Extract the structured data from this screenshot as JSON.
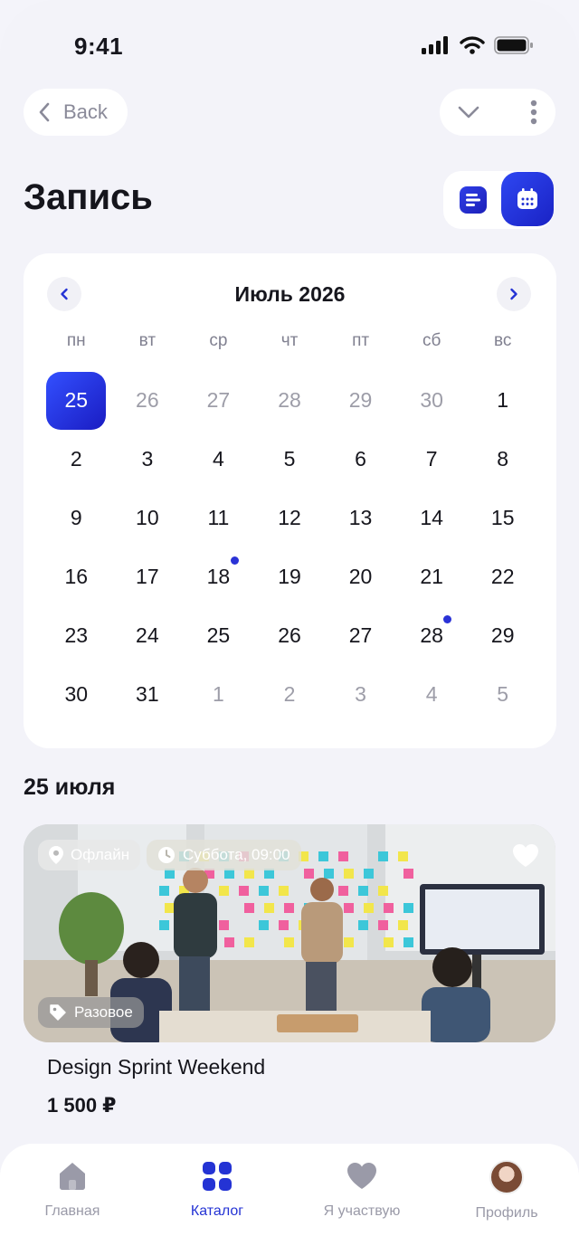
{
  "status_bar": {
    "time": "9:41"
  },
  "nav": {
    "back_label": "Back"
  },
  "page": {
    "title": "Запись"
  },
  "calendar": {
    "month_label": "Июль 2026",
    "weekdays": [
      "пн",
      "вт",
      "ср",
      "чт",
      "пт",
      "сб",
      "вс"
    ],
    "days": [
      {
        "label": "25",
        "muted": false,
        "selected": true,
        "event": false
      },
      {
        "label": "26",
        "muted": true,
        "selected": false,
        "event": false
      },
      {
        "label": "27",
        "muted": true,
        "selected": false,
        "event": false
      },
      {
        "label": "28",
        "muted": true,
        "selected": false,
        "event": false
      },
      {
        "label": "29",
        "muted": true,
        "selected": false,
        "event": false
      },
      {
        "label": "30",
        "muted": true,
        "selected": false,
        "event": false
      },
      {
        "label": "1",
        "muted": false,
        "selected": false,
        "event": false
      },
      {
        "label": "2",
        "muted": false,
        "selected": false,
        "event": false
      },
      {
        "label": "3",
        "muted": false,
        "selected": false,
        "event": false
      },
      {
        "label": "4",
        "muted": false,
        "selected": false,
        "event": false
      },
      {
        "label": "5",
        "muted": false,
        "selected": false,
        "event": false
      },
      {
        "label": "6",
        "muted": false,
        "selected": false,
        "event": false
      },
      {
        "label": "7",
        "muted": false,
        "selected": false,
        "event": false
      },
      {
        "label": "8",
        "muted": false,
        "selected": false,
        "event": false
      },
      {
        "label": "9",
        "muted": false,
        "selected": false,
        "event": false
      },
      {
        "label": "10",
        "muted": false,
        "selected": false,
        "event": false
      },
      {
        "label": "11",
        "muted": false,
        "selected": false,
        "event": false
      },
      {
        "label": "12",
        "muted": false,
        "selected": false,
        "event": false
      },
      {
        "label": "13",
        "muted": false,
        "selected": false,
        "event": false
      },
      {
        "label": "14",
        "muted": false,
        "selected": false,
        "event": false
      },
      {
        "label": "15",
        "muted": false,
        "selected": false,
        "event": false
      },
      {
        "label": "16",
        "muted": false,
        "selected": false,
        "event": false
      },
      {
        "label": "17",
        "muted": false,
        "selected": false,
        "event": false
      },
      {
        "label": "18",
        "muted": false,
        "selected": false,
        "event": true
      },
      {
        "label": "19",
        "muted": false,
        "selected": false,
        "event": false
      },
      {
        "label": "20",
        "muted": false,
        "selected": false,
        "event": false
      },
      {
        "label": "21",
        "muted": false,
        "selected": false,
        "event": false
      },
      {
        "label": "22",
        "muted": false,
        "selected": false,
        "event": false
      },
      {
        "label": "23",
        "muted": false,
        "selected": false,
        "event": false
      },
      {
        "label": "24",
        "muted": false,
        "selected": false,
        "event": false
      },
      {
        "label": "25",
        "muted": false,
        "selected": false,
        "event": false
      },
      {
        "label": "26",
        "muted": false,
        "selected": false,
        "event": false
      },
      {
        "label": "27",
        "muted": false,
        "selected": false,
        "event": false
      },
      {
        "label": "28",
        "muted": false,
        "selected": false,
        "event": true
      },
      {
        "label": "29",
        "muted": false,
        "selected": false,
        "event": false
      },
      {
        "label": "30",
        "muted": false,
        "selected": false,
        "event": false
      },
      {
        "label": "31",
        "muted": false,
        "selected": false,
        "event": false
      },
      {
        "label": "1",
        "muted": true,
        "selected": false,
        "event": false
      },
      {
        "label": "2",
        "muted": true,
        "selected": false,
        "event": false
      },
      {
        "label": "3",
        "muted": true,
        "selected": false,
        "event": false
      },
      {
        "label": "4",
        "muted": true,
        "selected": false,
        "event": false
      },
      {
        "label": "5",
        "muted": true,
        "selected": false,
        "event": false
      }
    ]
  },
  "section": {
    "date_label": "25 июля"
  },
  "event": {
    "format_chip": "Офлайн",
    "schedule_chip": "Суббота, 09:00",
    "type_chip": "Разовое",
    "title": "Design Sprint Weekend",
    "price": "1 500 ₽",
    "image_icon": "team-workshop-photo"
  },
  "tabs": [
    {
      "label": "Главная",
      "icon": "home-icon",
      "active": false
    },
    {
      "label": "Каталог",
      "icon": "grid-icon",
      "active": true
    },
    {
      "label": "Я участвую",
      "icon": "heart-icon",
      "active": false
    },
    {
      "label": "Профиль",
      "icon": "avatar",
      "active": false
    }
  ],
  "colors": {
    "accent": "#2433D4",
    "event_dot": "#2A32D6",
    "muted_text": "#9D9DA8"
  }
}
